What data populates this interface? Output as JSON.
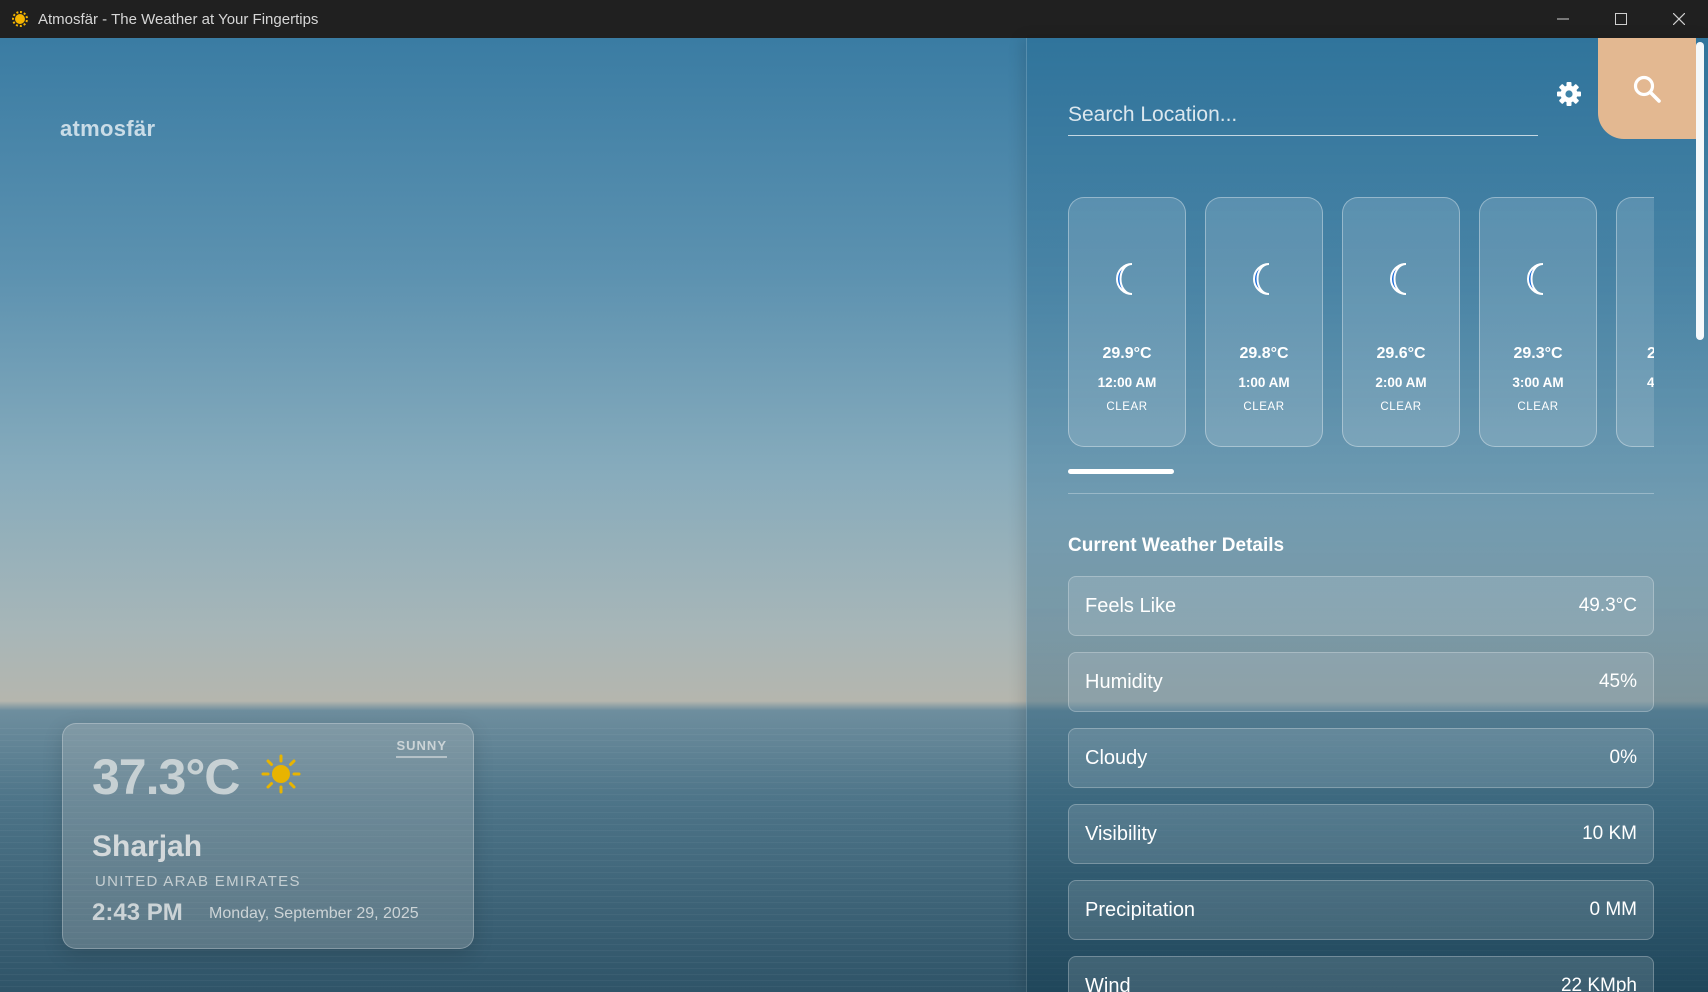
{
  "window": {
    "title": "Atmosfär - The Weather at Your Fingertips",
    "icon": "sun-icon"
  },
  "brand": "atmosfär",
  "current": {
    "temperature": "37.3°C",
    "condition": "SUNNY",
    "city": "Sharjah",
    "country": "UNITED ARAB EMIRATES",
    "time": "2:43 PM",
    "date": "Monday, September 29, 2025",
    "icon": "sun-icon"
  },
  "search": {
    "placeholder": "Search Location..."
  },
  "colors": {
    "search_button": "#e3b891",
    "moon_icon": "#1e6fd9",
    "sun_icon": "#e8b400"
  },
  "hourly": [
    {
      "temp": "29.9°C",
      "time": "12:00 AM",
      "condition": "CLEAR",
      "icon": "moon-icon"
    },
    {
      "temp": "29.8°C",
      "time": "1:00 AM",
      "condition": "CLEAR",
      "icon": "moon-icon"
    },
    {
      "temp": "29.6°C",
      "time": "2:00 AM",
      "condition": "CLEAR",
      "icon": "moon-icon"
    },
    {
      "temp": "29.3°C",
      "time": "3:00 AM",
      "condition": "CLEAR",
      "icon": "moon-icon"
    }
  ],
  "hourly_partial": {
    "temp": "2",
    "time": "4"
  },
  "details": {
    "title": "Current Weather Details",
    "rows": [
      {
        "label": "Feels Like",
        "value": "49.3°C"
      },
      {
        "label": "Humidity",
        "value": "45%"
      },
      {
        "label": "Cloudy",
        "value": "0%"
      },
      {
        "label": "Visibility",
        "value": "10 KM"
      },
      {
        "label": "Precipitation",
        "value": "0 MM"
      },
      {
        "label": "Wind",
        "value": "22 KMph"
      }
    ]
  }
}
